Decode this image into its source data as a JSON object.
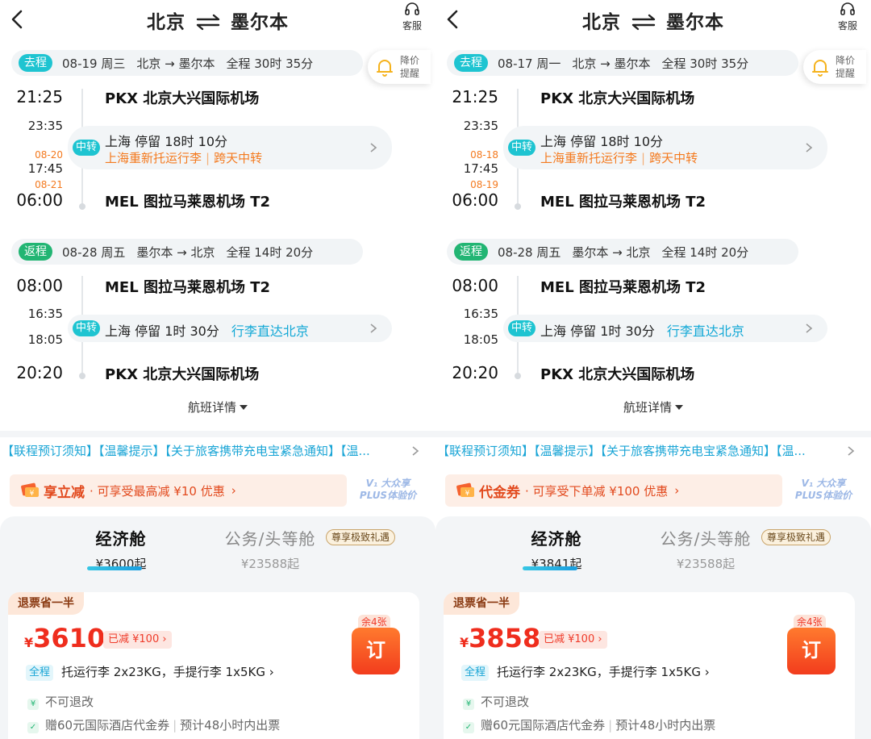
{
  "panels": [
    {
      "title": {
        "from": "北京",
        "to": "墨尔本"
      },
      "service_label": "客服",
      "price_alert": "降价提醒",
      "outbound": {
        "tag": "去程",
        "date": "08-19 周三",
        "route": "北京 → 墨尔本",
        "duration": "全程 30时 35分",
        "dep_time": "21:25",
        "dep_airport": "PKX 北京大兴国际机场",
        "stop_arr_time": "23:35",
        "stop_dep_date": "08-20",
        "stop_dep_time": "17:45",
        "arr_date": "08-21",
        "arr_time": "06:00",
        "arr_airport": "MEL 图拉马莱恩机场 T2",
        "stop_tag": "中转",
        "stop_city": "上海",
        "stop_stay": "停留 18时 10分",
        "stop_note1": "上海重新托运行李",
        "stop_note2": "跨天中转"
      },
      "return": {
        "tag": "返程",
        "date": "08-28 周五",
        "route": "墨尔本 → 北京",
        "duration": "全程 14时 20分",
        "dep_time": "08:00",
        "dep_airport": "MEL 图拉马莱恩机场 T2",
        "stop_arr_time": "16:35",
        "stop_dep_time": "18:05",
        "arr_time": "20:20",
        "arr_airport": "PKX 北京大兴国际机场",
        "stop_tag": "中转",
        "stop_city": "上海",
        "stop_stay": "停留 1时 30分",
        "stop_note": "行李直达北京"
      },
      "details_label": "航班详情",
      "notice": "【联程预订须知】【温馨提示】【关于旅客携带充电宝紧急通知】【温...",
      "promo": {
        "strong": "享立减",
        "sub": "· 可享受最高减 ¥10 优惠",
        "arrow": "›"
      },
      "plus_badge": {
        "line1": "V₁ 大众享",
        "line2": "PLUS体验价"
      },
      "cabins": {
        "economy": {
          "name": "经济舱",
          "price": "¥3600起"
        },
        "business": {
          "name": "公务/头等舱",
          "price": "¥23588起",
          "badge": "尊享极致礼遇"
        }
      },
      "fare": {
        "refund_tag": "退票省一半",
        "currency": "¥",
        "price": "3610",
        "discount": "已减 ¥100 ›",
        "seats_left": "余4张",
        "book": "订",
        "baggage_tag": "全程",
        "baggage": "托运行李 2x23KG，手提行李 1x5KG ›",
        "rule1": "不可退改",
        "rule2a": "赠60元国际酒店代金券",
        "rule2b": "预计48小时内出票"
      }
    },
    {
      "title": {
        "from": "北京",
        "to": "墨尔本"
      },
      "service_label": "客服",
      "price_alert": "降价提醒",
      "outbound": {
        "tag": "去程",
        "date": "08-17 周一",
        "route": "北京 → 墨尔本",
        "duration": "全程 30时 35分",
        "dep_time": "21:25",
        "dep_airport": "PKX 北京大兴国际机场",
        "stop_arr_time": "23:35",
        "stop_dep_date": "08-18",
        "stop_dep_time": "17:45",
        "arr_date": "08-19",
        "arr_time": "06:00",
        "arr_airport": "MEL 图拉马莱恩机场 T2",
        "stop_tag": "中转",
        "stop_city": "上海",
        "stop_stay": "停留 18时 10分",
        "stop_note1": "上海重新托运行李",
        "stop_note2": "跨天中转"
      },
      "return": {
        "tag": "返程",
        "date": "08-28 周五",
        "route": "墨尔本 → 北京",
        "duration": "全程 14时 20分",
        "dep_time": "08:00",
        "dep_airport": "MEL 图拉马莱恩机场 T2",
        "stop_arr_time": "16:35",
        "stop_dep_time": "18:05",
        "arr_time": "20:20",
        "arr_airport": "PKX 北京大兴国际机场",
        "stop_tag": "中转",
        "stop_city": "上海",
        "stop_stay": "停留 1时 30分",
        "stop_note": "行李直达北京"
      },
      "details_label": "航班详情",
      "notice": "【联程预订须知】【温馨提示】【关于旅客携带充电宝紧急通知】【温...",
      "promo": {
        "strong": "代金券",
        "sub": "· 可享受下单减 ¥100 优惠",
        "arrow": "›"
      },
      "plus_badge": {
        "line1": "V₁ 大众享",
        "line2": "PLUS体验价"
      },
      "cabins": {
        "economy": {
          "name": "经济舱",
          "price": "¥3841起"
        },
        "business": {
          "name": "公务/头等舱",
          "price": "¥23588起",
          "badge": "尊享极致礼遇"
        }
      },
      "fare": {
        "refund_tag": "退票省一半",
        "currency": "¥",
        "price": "3858",
        "discount": "已减 ¥100 ›",
        "seats_left": "余4张",
        "book": "订",
        "baggage_tag": "全程",
        "baggage": "托运行李 2x23KG，手提行李 1x5KG ›",
        "rule1": "不可退改",
        "rule2a": "赠60元国际酒店代金券",
        "rule2b": "预计48小时内出票"
      }
    }
  ],
  "colors": {
    "accent": "#1ec4d1",
    "return_tag": "#22b573",
    "orange": "#f47a1f",
    "price_red": "#ef2d1d",
    "link_blue": "#1aa5d6"
  },
  "icons": {
    "back": "chevron-left-icon",
    "service": "headset-icon",
    "alert": "bell-icon",
    "swap": "swap-arrows-icon"
  }
}
